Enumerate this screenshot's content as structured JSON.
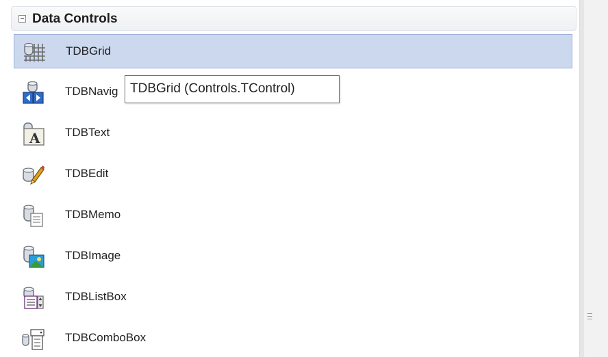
{
  "category": {
    "title": "Data Controls",
    "expanded": true
  },
  "items": [
    {
      "label": "TDBGrid",
      "icon": "db-grid-icon",
      "selected": true
    },
    {
      "label": "TDBNavig",
      "icon": "db-navigator-icon",
      "selected": false
    },
    {
      "label": "TDBText",
      "icon": "db-text-icon",
      "selected": false
    },
    {
      "label": "TDBEdit",
      "icon": "db-edit-icon",
      "selected": false
    },
    {
      "label": "TDBMemo",
      "icon": "db-memo-icon",
      "selected": false
    },
    {
      "label": "TDBImage",
      "icon": "db-image-icon",
      "selected": false
    },
    {
      "label": "TDBListBox",
      "icon": "db-listbox-icon",
      "selected": false
    },
    {
      "label": "TDBComboBox",
      "icon": "db-combobox-icon",
      "selected": false
    }
  ],
  "tooltip": {
    "text": "TDBGrid (Controls.TControl)"
  },
  "colors": {
    "selection_bg": "#ccd8ee",
    "selection_border": "#9aadd3"
  }
}
